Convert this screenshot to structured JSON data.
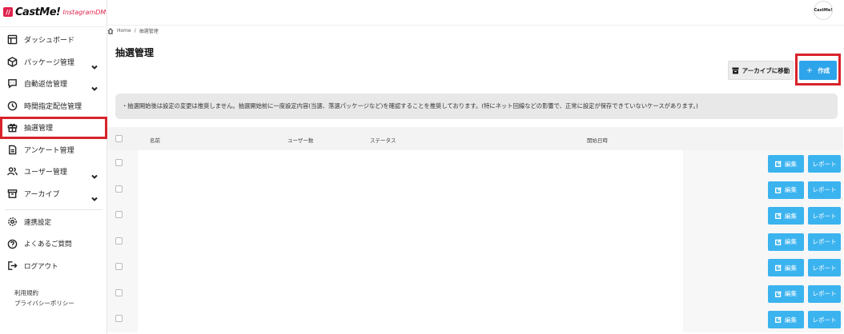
{
  "brand": {
    "mark": "//",
    "name": "CastMe!",
    "sub": "InstagramDM"
  },
  "avatar_text": "CastMe!",
  "sidebar": {
    "items": [
      {
        "label": "ダッシュボード",
        "icon": "layout-icon",
        "chevron": false
      },
      {
        "label": "パッケージ管理",
        "icon": "package-icon",
        "chevron": true
      },
      {
        "label": "自動返信管理",
        "icon": "chat-icon",
        "chevron": true
      },
      {
        "label": "時間指定配信管理",
        "icon": "clock-icon",
        "chevron": false
      },
      {
        "label": "抽選管理",
        "icon": "gift-icon",
        "chevron": false,
        "active": true
      },
      {
        "label": "アンケート管理",
        "icon": "document-icon",
        "chevron": false
      },
      {
        "label": "ユーザー管理",
        "icon": "users-icon",
        "chevron": true
      },
      {
        "label": "アーカイブ",
        "icon": "archive-icon",
        "chevron": true
      }
    ],
    "secondary": [
      {
        "label": "連携設定",
        "icon": "gear-icon"
      },
      {
        "label": "よくあるご質問",
        "icon": "help-icon"
      },
      {
        "label": "ログアウト",
        "icon": "logout-icon"
      }
    ],
    "legal": [
      "利用規約",
      "プライバシーポリシー"
    ]
  },
  "breadcrumb": {
    "home": "Home",
    "separator": "/",
    "current": "抽選管理"
  },
  "page_title": "抽選管理",
  "actions": {
    "archive_label": "アーカイブに移動",
    "create_plus": "+",
    "create_label": "作成"
  },
  "notice": "・抽選開始後は設定の変更は推奨しません。抽選開始前に一度設定内容(当選、落選パッケージなど)を確認することを推奨しております。(特にネット回線などの影響で、正常に設定が保存できていないケースがあります。)",
  "table": {
    "columns": [
      "名前",
      "ユーザー数",
      "ステータス",
      "開始日時"
    ],
    "edit_label": "編集",
    "report_label": "レポート",
    "row_count": 7
  },
  "colors": {
    "accent": "#2ea4ea",
    "highlight": "#d8232a",
    "brand": "#e0224b"
  }
}
